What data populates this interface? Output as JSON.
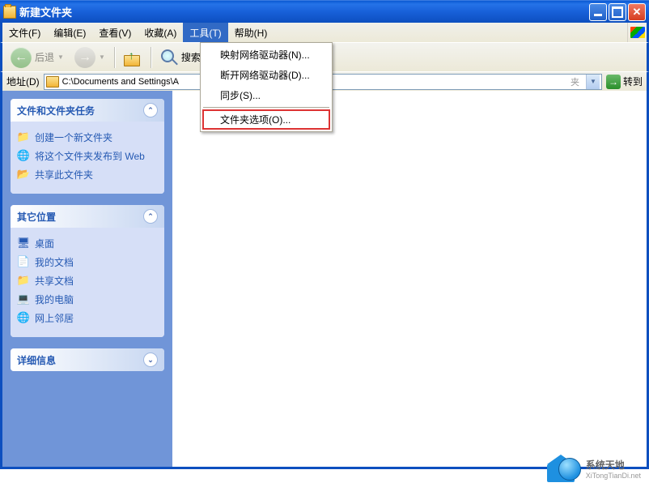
{
  "titlebar": {
    "title": "新建文件夹"
  },
  "menubar": {
    "items": [
      {
        "label": "文件(F)"
      },
      {
        "label": "编辑(E)"
      },
      {
        "label": "查看(V)"
      },
      {
        "label": "收藏(A)"
      },
      {
        "label": "工具(T)"
      },
      {
        "label": "帮助(H)"
      }
    ]
  },
  "dropdown": {
    "items": [
      {
        "label": "映射网络驱动器(N)..."
      },
      {
        "label": "断开网络驱动器(D)..."
      },
      {
        "label": "同步(S)..."
      },
      {
        "label": "文件夹选项(O)..."
      }
    ]
  },
  "toolbar": {
    "back_label": "后退",
    "search_label": "搜索"
  },
  "addressbar": {
    "label": "地址(D)",
    "path": "C:\\Documents and Settings\\A",
    "go_label": "转到"
  },
  "sidebar": {
    "panels": [
      {
        "title": "文件和文件夹任务",
        "items": [
          {
            "icon": "folder-new-icon",
            "glyph": "📁",
            "label": "创建一个新文件夹"
          },
          {
            "icon": "publish-web-icon",
            "glyph": "🌐",
            "label": "将这个文件夹发布到 Web"
          },
          {
            "icon": "share-folder-icon",
            "glyph": "📂",
            "label": "共享此文件夹"
          }
        ]
      },
      {
        "title": "其它位置",
        "items": [
          {
            "icon": "desktop-icon",
            "glyph": "🖥",
            "label": "桌面"
          },
          {
            "icon": "my-documents-icon",
            "glyph": "📄",
            "label": "我的文档"
          },
          {
            "icon": "shared-docs-icon",
            "glyph": "📁",
            "label": "共享文档"
          },
          {
            "icon": "my-computer-icon",
            "glyph": "💻",
            "label": "我的电脑"
          },
          {
            "icon": "network-places-icon",
            "glyph": "🌐",
            "label": "网上邻居"
          }
        ]
      },
      {
        "title": "详细信息",
        "items": []
      }
    ]
  },
  "watermark": {
    "brand": "系统天地",
    "url": "XiTongTianDi.net"
  }
}
